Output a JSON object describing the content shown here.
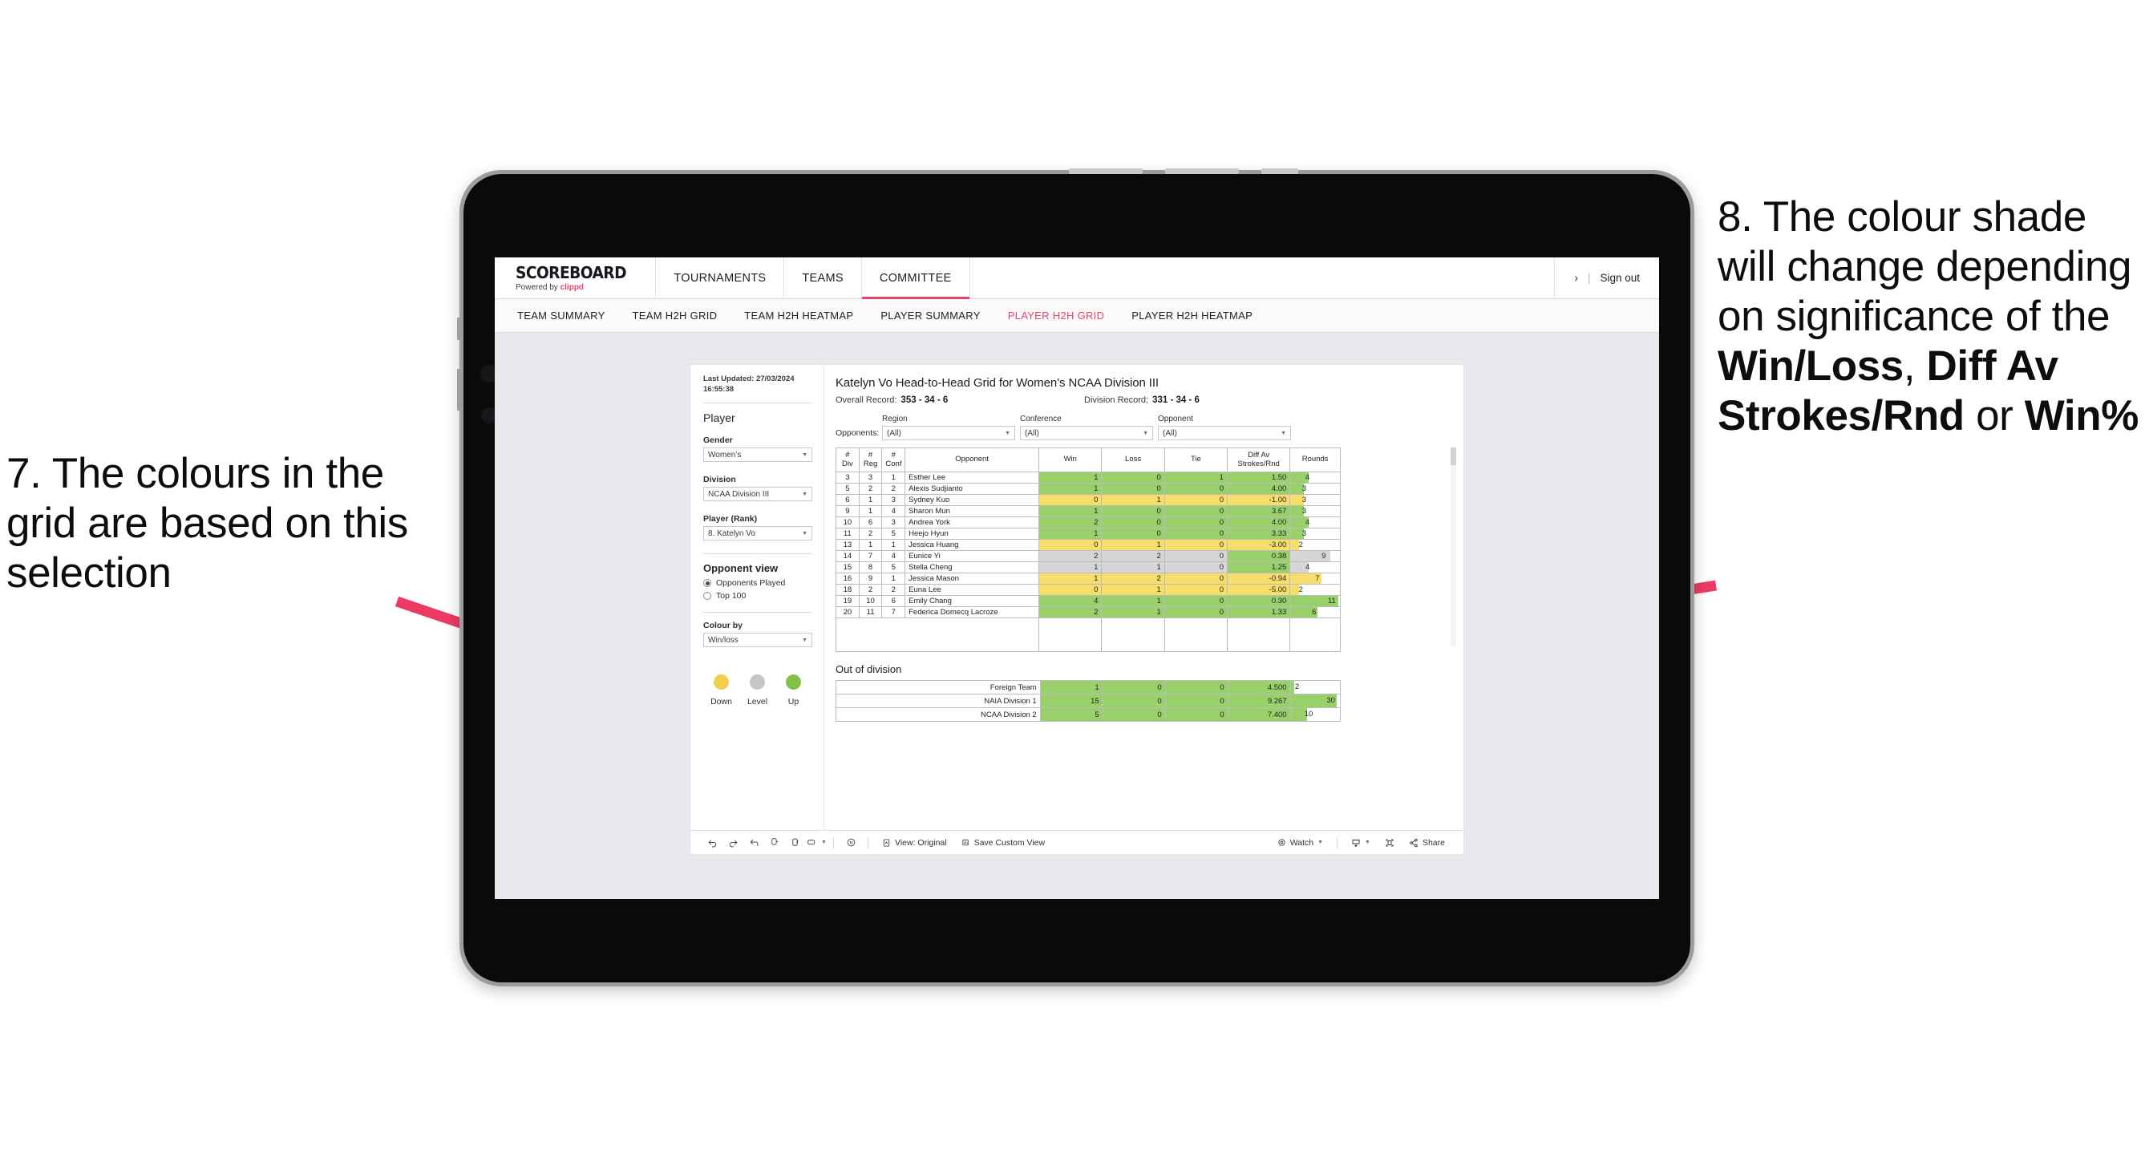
{
  "annotations": {
    "left": {
      "id": "annotation-7",
      "text": "7. The colours in the grid are based on this selection"
    },
    "right": {
      "id": "annotation-8",
      "prefix": "8. The colour shade will change depending on significance of the ",
      "bold_1": "Win/Loss",
      "mid_1": ", ",
      "bold_2": "Diff Av Strokes/Rnd",
      "mid_2": " or ",
      "bold_3": "Win%"
    },
    "arrow_color": "#ec3a63"
  },
  "app": {
    "brand": {
      "title": "SCOREBOARD",
      "powered_prefix": "Powered by ",
      "powered_brand": "clippd"
    },
    "topnav": {
      "items": [
        {
          "label": "TOURNAMENTS",
          "active": false
        },
        {
          "label": "TEAMS",
          "active": false
        },
        {
          "label": "COMMITTEE",
          "active": true
        }
      ],
      "chevron": "›",
      "separator": "|",
      "signout": "Sign out"
    },
    "subnav": {
      "items": [
        {
          "label": "TEAM SUMMARY",
          "active": false
        },
        {
          "label": "TEAM H2H GRID",
          "active": false
        },
        {
          "label": "TEAM H2H HEATMAP",
          "active": false
        },
        {
          "label": "PLAYER SUMMARY",
          "active": false
        },
        {
          "label": "PLAYER H2H GRID",
          "active": true
        },
        {
          "label": "PLAYER H2H HEATMAP",
          "active": false
        }
      ]
    }
  },
  "pane": {
    "last_updated": "Last Updated: 27/03/2024 16:55:38",
    "heading": "Player",
    "fields": [
      {
        "label": "Gender",
        "value": "Women’s"
      },
      {
        "label": "Division",
        "value": "NCAA Division III"
      },
      {
        "label": "Player (Rank)",
        "value": "8. Katelyn Vo"
      }
    ],
    "opponent_view": {
      "heading": "Opponent view",
      "options": [
        {
          "label": "Opponents Played",
          "selected": true
        },
        {
          "label": "Top 100",
          "selected": false
        }
      ]
    },
    "colour_by": {
      "label": "Colour by",
      "value": "Win/loss"
    },
    "legend": [
      {
        "label": "Down",
        "color": "#f2cf4a"
      },
      {
        "label": "Level",
        "color": "#c4c6c8"
      },
      {
        "label": "Up",
        "color": "#7ec24c"
      }
    ]
  },
  "viz": {
    "title": "Katelyn Vo Head-to-Head Grid for Women’s NCAA Division III",
    "overall_record_label": "Overall Record:",
    "overall_record_value": "353 -  34 - 6",
    "division_record_label": "Division Record:",
    "division_record_value": "331 -  34 - 6",
    "opponents_label": "Opponents:",
    "opponent_filters": [
      {
        "label": "Region",
        "value": "(All)"
      },
      {
        "label": "Conference",
        "value": "(All)"
      },
      {
        "label": "Opponent",
        "value": "(All)"
      }
    ],
    "grid": {
      "headers": [
        "#\nDiv",
        "#\nReg",
        "#\nConf",
        "Opponent",
        "Win",
        "Loss",
        "Tie",
        "Diff Av\nStrokes/Rnd",
        "Rounds"
      ],
      "header_labels": {
        "div_line1": "#",
        "div_line2": "Div",
        "reg_line1": "#",
        "reg_line2": "Reg",
        "conf_line1": "#",
        "conf_line2": "Conf",
        "opponent": "Opponent",
        "win": "Win",
        "loss": "Loss",
        "tie": "Tie",
        "diff_line1": "Diff Av",
        "diff_line2": "Strokes/Rnd",
        "rounds": "Rounds"
      },
      "rows": [
        {
          "div": "3",
          "reg": "3",
          "conf": "1",
          "opponent": "Esther Lee",
          "win": "1",
          "loss": "0",
          "tie": "1",
          "diff": "1.50",
          "rounds": "4",
          "color": "green",
          "bar_pct": 36
        },
        {
          "div": "5",
          "reg": "2",
          "conf": "2",
          "opponent": "Alexis Sudjianto",
          "win": "1",
          "loss": "0",
          "tie": "0",
          "diff": "4.00",
          "rounds": "3",
          "color": "green",
          "bar_pct": 27
        },
        {
          "div": "6",
          "reg": "1",
          "conf": "3",
          "opponent": "Sydney Kuo",
          "win": "0",
          "loss": "1",
          "tie": "0",
          "diff": "-1.00",
          "rounds": "3",
          "color": "yellow",
          "bar_pct": 27
        },
        {
          "div": "9",
          "reg": "1",
          "conf": "4",
          "opponent": "Sharon Mun",
          "win": "1",
          "loss": "0",
          "tie": "0",
          "diff": "3.67",
          "rounds": "3",
          "color": "green",
          "bar_pct": 27
        },
        {
          "div": "10",
          "reg": "6",
          "conf": "3",
          "opponent": "Andrea York",
          "win": "2",
          "loss": "0",
          "tie": "0",
          "diff": "4.00",
          "rounds": "4",
          "color": "green",
          "bar_pct": 36
        },
        {
          "div": "11",
          "reg": "2",
          "conf": "5",
          "opponent": "Heejo Hyun",
          "win": "1",
          "loss": "0",
          "tie": "0",
          "diff": "3.33",
          "rounds": "3",
          "color": "green",
          "bar_pct": 27
        },
        {
          "div": "13",
          "reg": "1",
          "conf": "1",
          "opponent": "Jessica Huang",
          "win": "0",
          "loss": "1",
          "tie": "0",
          "diff": "-3.00",
          "rounds": "2",
          "color": "yellow",
          "bar_pct": 18
        },
        {
          "div": "14",
          "reg": "7",
          "conf": "4",
          "opponent": "Eunice Yi",
          "win": "2",
          "loss": "2",
          "tie": "0",
          "diff": "0.38",
          "rounds": "9",
          "color": "grey",
          "bar_pct": 80,
          "diff_color": "green"
        },
        {
          "div": "15",
          "reg": "8",
          "conf": "5",
          "opponent": "Stella Cheng",
          "win": "1",
          "loss": "1",
          "tie": "0",
          "diff": "1.25",
          "rounds": "4",
          "color": "grey",
          "bar_pct": 36,
          "diff_color": "green"
        },
        {
          "div": "16",
          "reg": "9",
          "conf": "1",
          "opponent": "Jessica Mason",
          "win": "1",
          "loss": "2",
          "tie": "0",
          "diff": "-0.94",
          "rounds": "7",
          "color": "yellow",
          "bar_pct": 63
        },
        {
          "div": "18",
          "reg": "2",
          "conf": "2",
          "opponent": "Euna Lee",
          "win": "0",
          "loss": "1",
          "tie": "0",
          "diff": "-5.00",
          "rounds": "2",
          "color": "yellow",
          "bar_pct": 18
        },
        {
          "div": "19",
          "reg": "10",
          "conf": "6",
          "opponent": "Emily Chang",
          "win": "4",
          "loss": "1",
          "tie": "0",
          "diff": "0.30",
          "rounds": "11",
          "color": "green",
          "bar_pct": 97
        },
        {
          "div": "20",
          "reg": "11",
          "conf": "7",
          "opponent": "Federica Domecq Lacroze",
          "win": "2",
          "loss": "1",
          "tie": "0",
          "diff": "1.33",
          "rounds": "6",
          "color": "green",
          "bar_pct": 54
        }
      ]
    },
    "out_of_division": {
      "title": "Out of division",
      "rows": [
        {
          "name": "Foreign Team",
          "win": "1",
          "loss": "0",
          "tie": "0",
          "diff": "4.500",
          "rounds": "2",
          "color": "green",
          "bar_pct": 7
        },
        {
          "name": "NAIA Division 1",
          "win": "15",
          "loss": "0",
          "tie": "0",
          "diff": "9.267",
          "rounds": "30",
          "color": "green",
          "bar_pct": 93
        },
        {
          "name": "NCAA Division 2",
          "win": "5",
          "loss": "0",
          "tie": "0",
          "diff": "7.400",
          "rounds": "10",
          "color": "green",
          "bar_pct": 33
        }
      ]
    }
  },
  "toolbar": {
    "icons": [
      "undo-icon",
      "redo-icon",
      "revert-icon",
      "refresh-icon",
      "pause-icon",
      "device-layout-icon"
    ],
    "view_original": "View: Original",
    "save_custom_view": "Save Custom View",
    "watch": "Watch",
    "share": "Share"
  },
  "colors": {
    "green": "#98d169",
    "yellow": "#f7dd6a",
    "grey": "#d6d6d6",
    "accent_pink": "#e8436b",
    "canvas": "#e7e9ec"
  }
}
